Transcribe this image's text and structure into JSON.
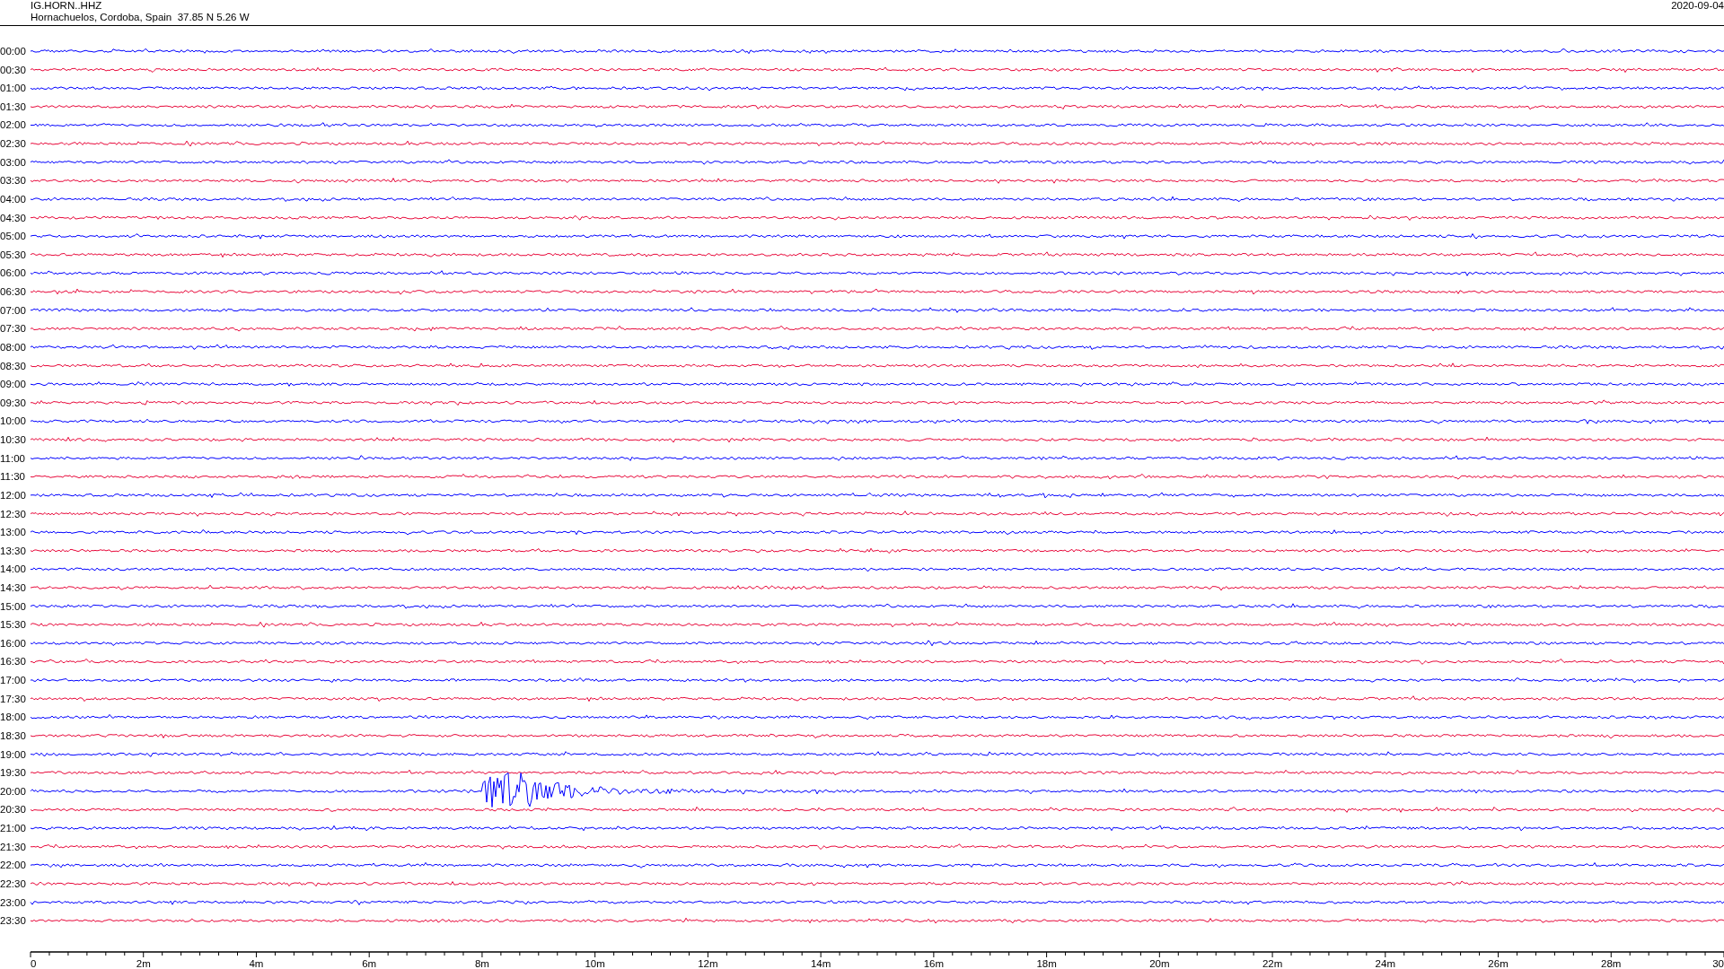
{
  "header": {
    "station": "IG.HORN..HHZ",
    "location": "Hornachuelos, Cordoba, Spain  37.85 N 5.26 W",
    "date": "2020-09-04"
  },
  "rows": [
    {
      "label": "00:00",
      "color": "#0000ff"
    },
    {
      "label": "00:30",
      "color": "#e8083a"
    },
    {
      "label": "01:00",
      "color": "#0000ff"
    },
    {
      "label": "01:30",
      "color": "#e8083a"
    },
    {
      "label": "02:00",
      "color": "#0000ff"
    },
    {
      "label": "02:30",
      "color": "#e8083a"
    },
    {
      "label": "03:00",
      "color": "#0000ff"
    },
    {
      "label": "03:30",
      "color": "#e8083a"
    },
    {
      "label": "04:00",
      "color": "#0000ff"
    },
    {
      "label": "04:30",
      "color": "#e8083a"
    },
    {
      "label": "05:00",
      "color": "#0000ff"
    },
    {
      "label": "05:30",
      "color": "#e8083a"
    },
    {
      "label": "06:00",
      "color": "#0000ff"
    },
    {
      "label": "06:30",
      "color": "#e8083a"
    },
    {
      "label": "07:00",
      "color": "#0000ff"
    },
    {
      "label": "07:30",
      "color": "#e8083a"
    },
    {
      "label": "08:00",
      "color": "#0000ff"
    },
    {
      "label": "08:30",
      "color": "#e8083a"
    },
    {
      "label": "09:00",
      "color": "#0000ff"
    },
    {
      "label": "09:30",
      "color": "#e8083a"
    },
    {
      "label": "10:00",
      "color": "#0000ff"
    },
    {
      "label": "10:30",
      "color": "#e8083a"
    },
    {
      "label": "11:00",
      "color": "#0000ff"
    },
    {
      "label": "11:30",
      "color": "#e8083a"
    },
    {
      "label": "12:00",
      "color": "#0000ff"
    },
    {
      "label": "12:30",
      "color": "#e8083a"
    },
    {
      "label": "13:00",
      "color": "#0000ff"
    },
    {
      "label": "13:30",
      "color": "#e8083a"
    },
    {
      "label": "14:00",
      "color": "#0000ff"
    },
    {
      "label": "14:30",
      "color": "#e8083a"
    },
    {
      "label": "15:00",
      "color": "#0000ff"
    },
    {
      "label": "15:30",
      "color": "#e8083a"
    },
    {
      "label": "16:00",
      "color": "#0000ff"
    },
    {
      "label": "16:30",
      "color": "#e8083a"
    },
    {
      "label": "17:00",
      "color": "#0000ff"
    },
    {
      "label": "17:30",
      "color": "#e8083a"
    },
    {
      "label": "18:00",
      "color": "#0000ff"
    },
    {
      "label": "18:30",
      "color": "#e8083a"
    },
    {
      "label": "19:00",
      "color": "#0000ff"
    },
    {
      "label": "19:30",
      "color": "#e8083a"
    },
    {
      "label": "20:00",
      "color": "#0000ff"
    },
    {
      "label": "20:30",
      "color": "#e8083a"
    },
    {
      "label": "21:00",
      "color": "#0000ff"
    },
    {
      "label": "21:30",
      "color": "#e8083a"
    },
    {
      "label": "22:00",
      "color": "#0000ff"
    },
    {
      "label": "22:30",
      "color": "#e8083a"
    },
    {
      "label": "23:00",
      "color": "#0000ff"
    },
    {
      "label": "23:30",
      "color": "#e8083a"
    }
  ],
  "axis": {
    "labels": [
      "0",
      "2m",
      "4m",
      "6m",
      "8m",
      "10m",
      "12m",
      "14m",
      "16m",
      "18m",
      "20m",
      "22m",
      "24m",
      "26m",
      "28m",
      "30"
    ]
  }
}
